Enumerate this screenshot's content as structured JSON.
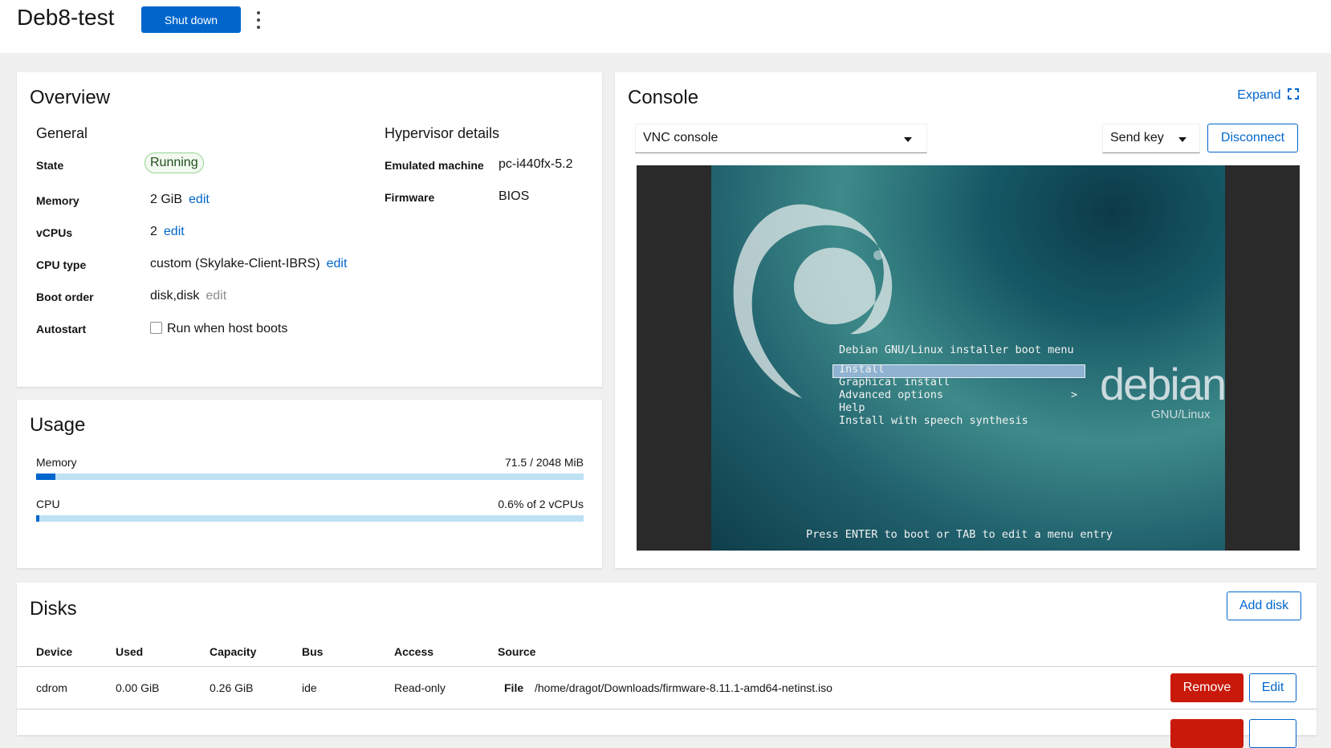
{
  "header": {
    "vm_name": "Deb8-test",
    "shutdown_label": "Shut down"
  },
  "overview": {
    "title": "Overview",
    "general_title": "General",
    "hypervisor_title": "Hypervisor details",
    "rows": {
      "state_label": "State",
      "state_value": "Running",
      "memory_label": "Memory",
      "memory_value": "2 GiB",
      "vcpus_label": "vCPUs",
      "vcpus_value": "2",
      "cpu_type_label": "CPU type",
      "cpu_type_value": "custom (Skylake-Client-IBRS)",
      "boot_order_label": "Boot order",
      "boot_order_value": "disk,disk",
      "autostart_label": "Autostart",
      "autostart_value": "Run when host boots",
      "edit_label": "edit"
    },
    "hypervisor": {
      "machine_label": "Emulated machine",
      "machine_value": "pc-i440fx-5.2",
      "firmware_label": "Firmware",
      "firmware_value": "BIOS"
    }
  },
  "usage": {
    "title": "Usage",
    "memory_label": "Memory",
    "memory_value": "71.5 / 2048 MiB",
    "memory_fraction": 0.035,
    "cpu_label": "CPU",
    "cpu_value": "0.6% of 2 vCPUs",
    "cpu_fraction": 0.006
  },
  "console": {
    "title": "Console",
    "expand_label": "Expand",
    "type_select": "VNC console",
    "send_key_label": "Send key",
    "disconnect_label": "Disconnect",
    "screen": {
      "menu_title": "Debian GNU/Linux installer boot menu",
      "items": [
        "Install",
        "Graphical install",
        "Advanced options",
        "Help",
        "Install with speech synthesis"
      ],
      "submenu_arrow": ">",
      "logo_text": "debian",
      "logo_sub": "GNU/Linux",
      "footer": "Press ENTER to boot or TAB to edit a menu entry"
    }
  },
  "disks": {
    "title": "Disks",
    "add_label": "Add disk",
    "columns": [
      "Device",
      "Used",
      "Capacity",
      "Bus",
      "Access",
      "Source"
    ],
    "rows": [
      {
        "device": "cdrom",
        "used": "0.00 GiB",
        "capacity": "0.26 GiB",
        "bus": "ide",
        "access": "Read-only",
        "source_label": "File",
        "source_value": "/home/dragot/Downloads/firmware-8.11.1-amd64-netinst.iso"
      }
    ],
    "remove_label": "Remove",
    "edit_label": "Edit"
  },
  "colors": {
    "primary": "#0066cc",
    "danger": "#c9190b",
    "running_border": "#95d58e",
    "bar_track": "#bee1f4"
  }
}
